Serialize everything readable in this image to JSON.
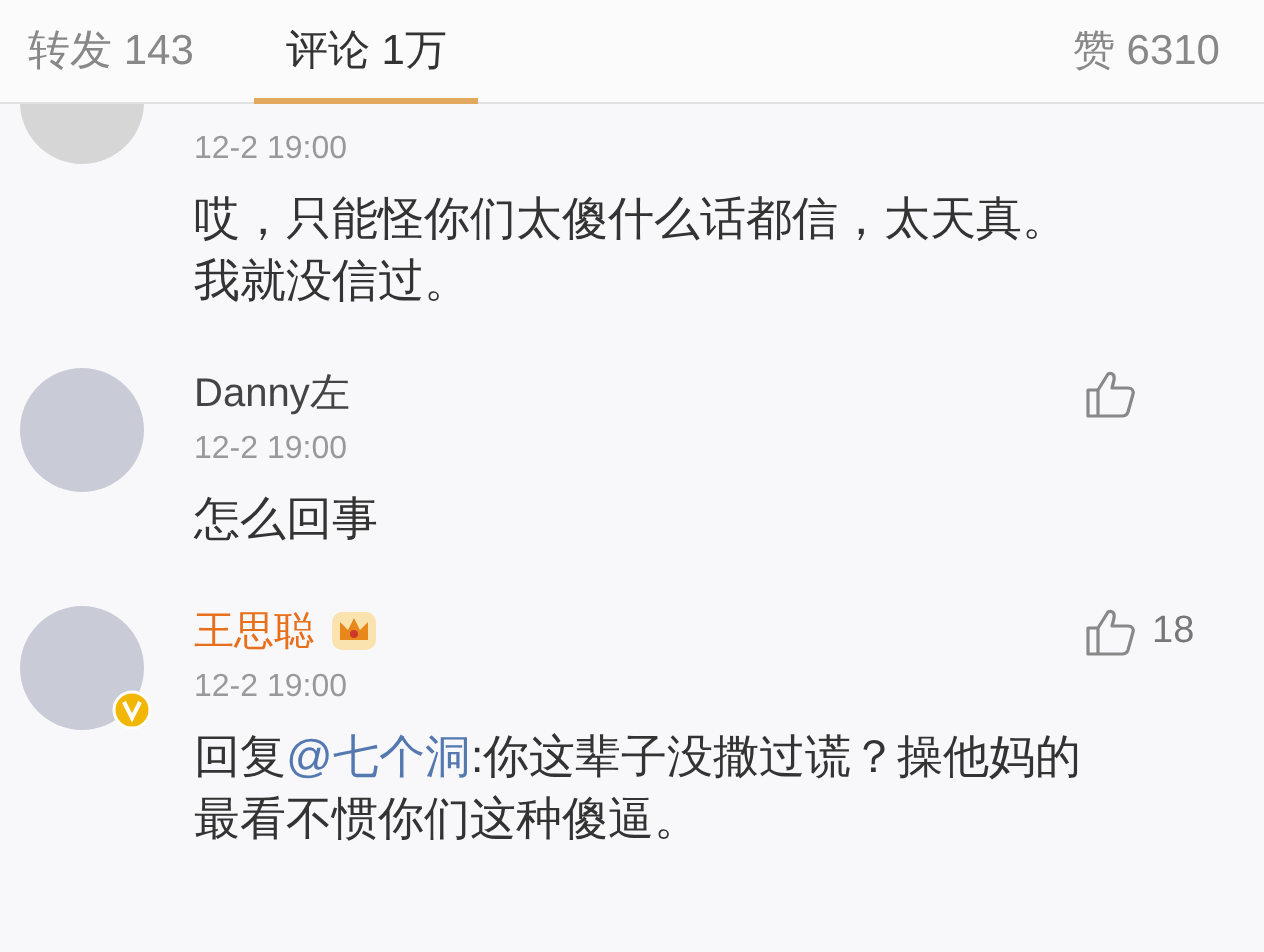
{
  "tabs": [
    {
      "label": "转发 143",
      "selected": false
    },
    {
      "label": "评论 1万",
      "selected": true
    }
  ],
  "likes_tab": {
    "label": "赞 6310"
  },
  "comments": [
    {
      "cut": true,
      "time": "12-2 19:00",
      "like_icon": false,
      "vip": false,
      "verified": false,
      "body": [
        {
          "kind": "text",
          "text": "哎，只能怪你们太傻什么话都信，太天真。我就没信过。"
        }
      ]
    },
    {
      "cut": false,
      "name": "Danny左",
      "time": "12-2 19:00",
      "like_icon": true,
      "vip": false,
      "verified": false,
      "body": [
        {
          "kind": "text",
          "text": "怎么回事"
        }
      ]
    },
    {
      "cut": false,
      "name": "王思聪",
      "time": "12-2 19:00",
      "like_icon": true,
      "likes": "18",
      "vip": true,
      "verified": true,
      "body": [
        {
          "kind": "text",
          "text": "回复"
        },
        {
          "kind": "mention",
          "text": "@七个洞"
        },
        {
          "kind": "text",
          "text": ":你这辈子没撒过谎？操他妈的最看不惯你们这种傻逼。"
        }
      ]
    }
  ]
}
